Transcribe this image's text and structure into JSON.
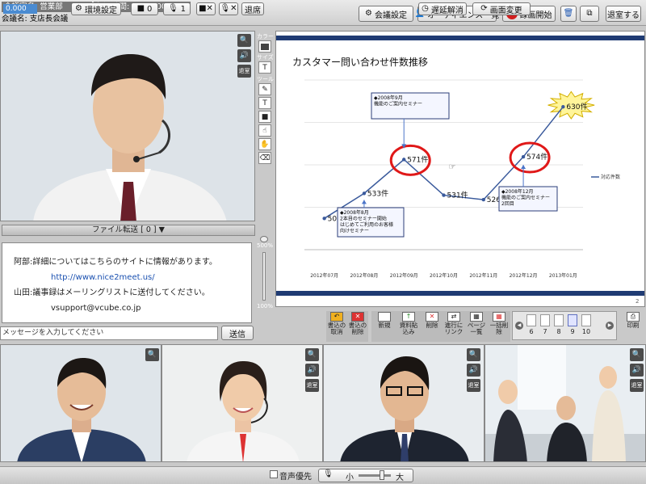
{
  "header": {
    "room_label": "会議室名: 営業部",
    "elapsed_label": "経過時間:",
    "elapsed_value": "00:00:00",
    "meeting_label": "会議名: 支店長会議",
    "buttons": {
      "settings": "会議設定",
      "audience": "オーディエンス一覧",
      "record": "録画開始",
      "record_badge": "REC",
      "exit": "退室する"
    }
  },
  "main_video": {
    "counter": "0.000",
    "exit_small": "退室"
  },
  "file_transfer": {
    "label": "ファイル転送",
    "count": "[ 0 ]"
  },
  "chat": {
    "messages": [
      {
        "name": "阿部",
        "text": ":詳細についてはこちらのサイトに情報があります。"
      },
      {
        "link": "http://www.nice2meet.us/"
      },
      {
        "name": "山田",
        "text": ":議事録はメーリングリストに送付してください。"
      },
      {
        "plain": "vsupport@vcube.co.jp"
      }
    ],
    "input_placeholder": "メッセージを入力してください",
    "send_label": "送信",
    "zoom_top": "500%",
    "zoom_bottom": "100%"
  },
  "tools": {
    "color_label": "カラー",
    "size_label": "サイズ",
    "tool_label": "ツール"
  },
  "slide": {
    "page_number": "2",
    "chart_data": {
      "type": "line",
      "title": "カスタマー問い合わせ件数推移",
      "categories": [
        "2012年07月",
        "2012年08月",
        "2012年09月",
        "2012年10月",
        "2012年11月",
        "2012年12月",
        "2013年01月"
      ],
      "series": [
        {
          "name": "対応件数",
          "values": [
            505,
            533,
            571,
            531,
            526,
            574,
            630
          ]
        }
      ],
      "data_labels": [
        "505件",
        "533件",
        "571件",
        "531件",
        "526件",
        "574件",
        "630件"
      ],
      "legend": "right",
      "annotations": [
        {
          "lines": [
            "◆2008年9月",
            "機能のご案内セミナー"
          ]
        },
        {
          "lines": [
            "◆2008年8月",
            "2本目のセミナー開始",
            "はじめてご利用のお客様",
            "向けセミナー"
          ]
        },
        {
          "lines": [
            "◆2008年12月",
            "機能のご案内セミナー",
            "2回目"
          ]
        }
      ]
    }
  },
  "bottom_tools": {
    "undo": "書込の取消",
    "clear": "書込の削除",
    "new": "新規",
    "paste": "資料貼込み",
    "delete": "削除",
    "link": "進行にリンク",
    "page_list": "ページ一覧",
    "bulk_delete": "一括削除",
    "pages": [
      "6",
      "7",
      "8",
      "9",
      "10"
    ],
    "print": "印刷"
  },
  "participants": [
    {
      "exit": "退室"
    },
    {
      "exit": "退室"
    },
    {
      "exit": "退室"
    },
    {
      "exit": "退室"
    }
  ],
  "footer": {
    "env_settings": "環境設定",
    "cam_count": "0",
    "mic_count": "1",
    "exit_label": "退席",
    "voice_priority": "音声優先",
    "vol_low": "小",
    "vol_high": "大",
    "delay_release": "遅延解消",
    "screen_change": "画面変更"
  },
  "colors": {
    "accent_blue": "#1f3b73",
    "rec_red": "#d21f1f",
    "circle_red": "#e01818"
  }
}
